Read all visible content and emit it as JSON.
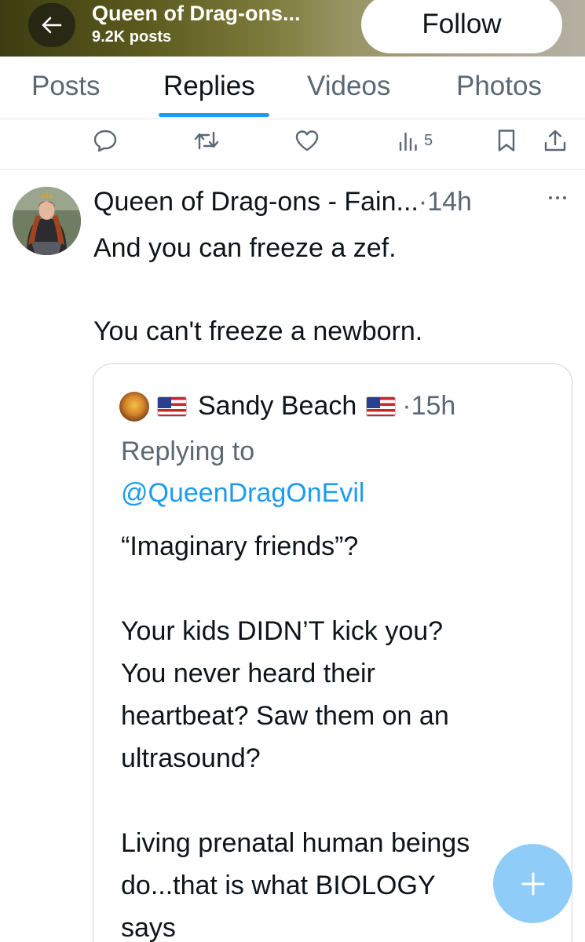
{
  "header": {
    "title": "Queen of Drag-ons...",
    "post_count": "9.2K posts",
    "follow_label": "Follow"
  },
  "tabs": [
    {
      "label": "Posts"
    },
    {
      "label": "Replies"
    },
    {
      "label": "Videos"
    },
    {
      "label": "Photos"
    }
  ],
  "actions": {
    "views": "5",
    "icons": [
      "reply-icon",
      "retweet-icon",
      "like-icon",
      "views-icon",
      "bookmark-icon",
      "share-icon"
    ]
  },
  "tweet": {
    "author": "Queen of Drag-ons - Fain...",
    "separator": "·",
    "time": "14h",
    "lines": [
      "And you can freeze a zef.",
      "",
      "You can't freeze a newborn."
    ]
  },
  "quote": {
    "author": "Sandy Beach",
    "separator": "·",
    "time": "15h",
    "replying_to": "Replying to",
    "handle": "@QueenDragOnEvil",
    "lines": [
      "“Imaginary friends”?",
      "",
      "Your kids DIDN’T kick you?",
      "You never heard their",
      "heartbeat? Saw them on an",
      "ultrasound?",
      "",
      "Living prenatal human beings",
      "do...that is what BIOLOGY",
      "says"
    ]
  },
  "colors": {
    "accent": "#1d9bf0",
    "secondary_text": "#5b6873",
    "fab": "#8fcdf8"
  }
}
